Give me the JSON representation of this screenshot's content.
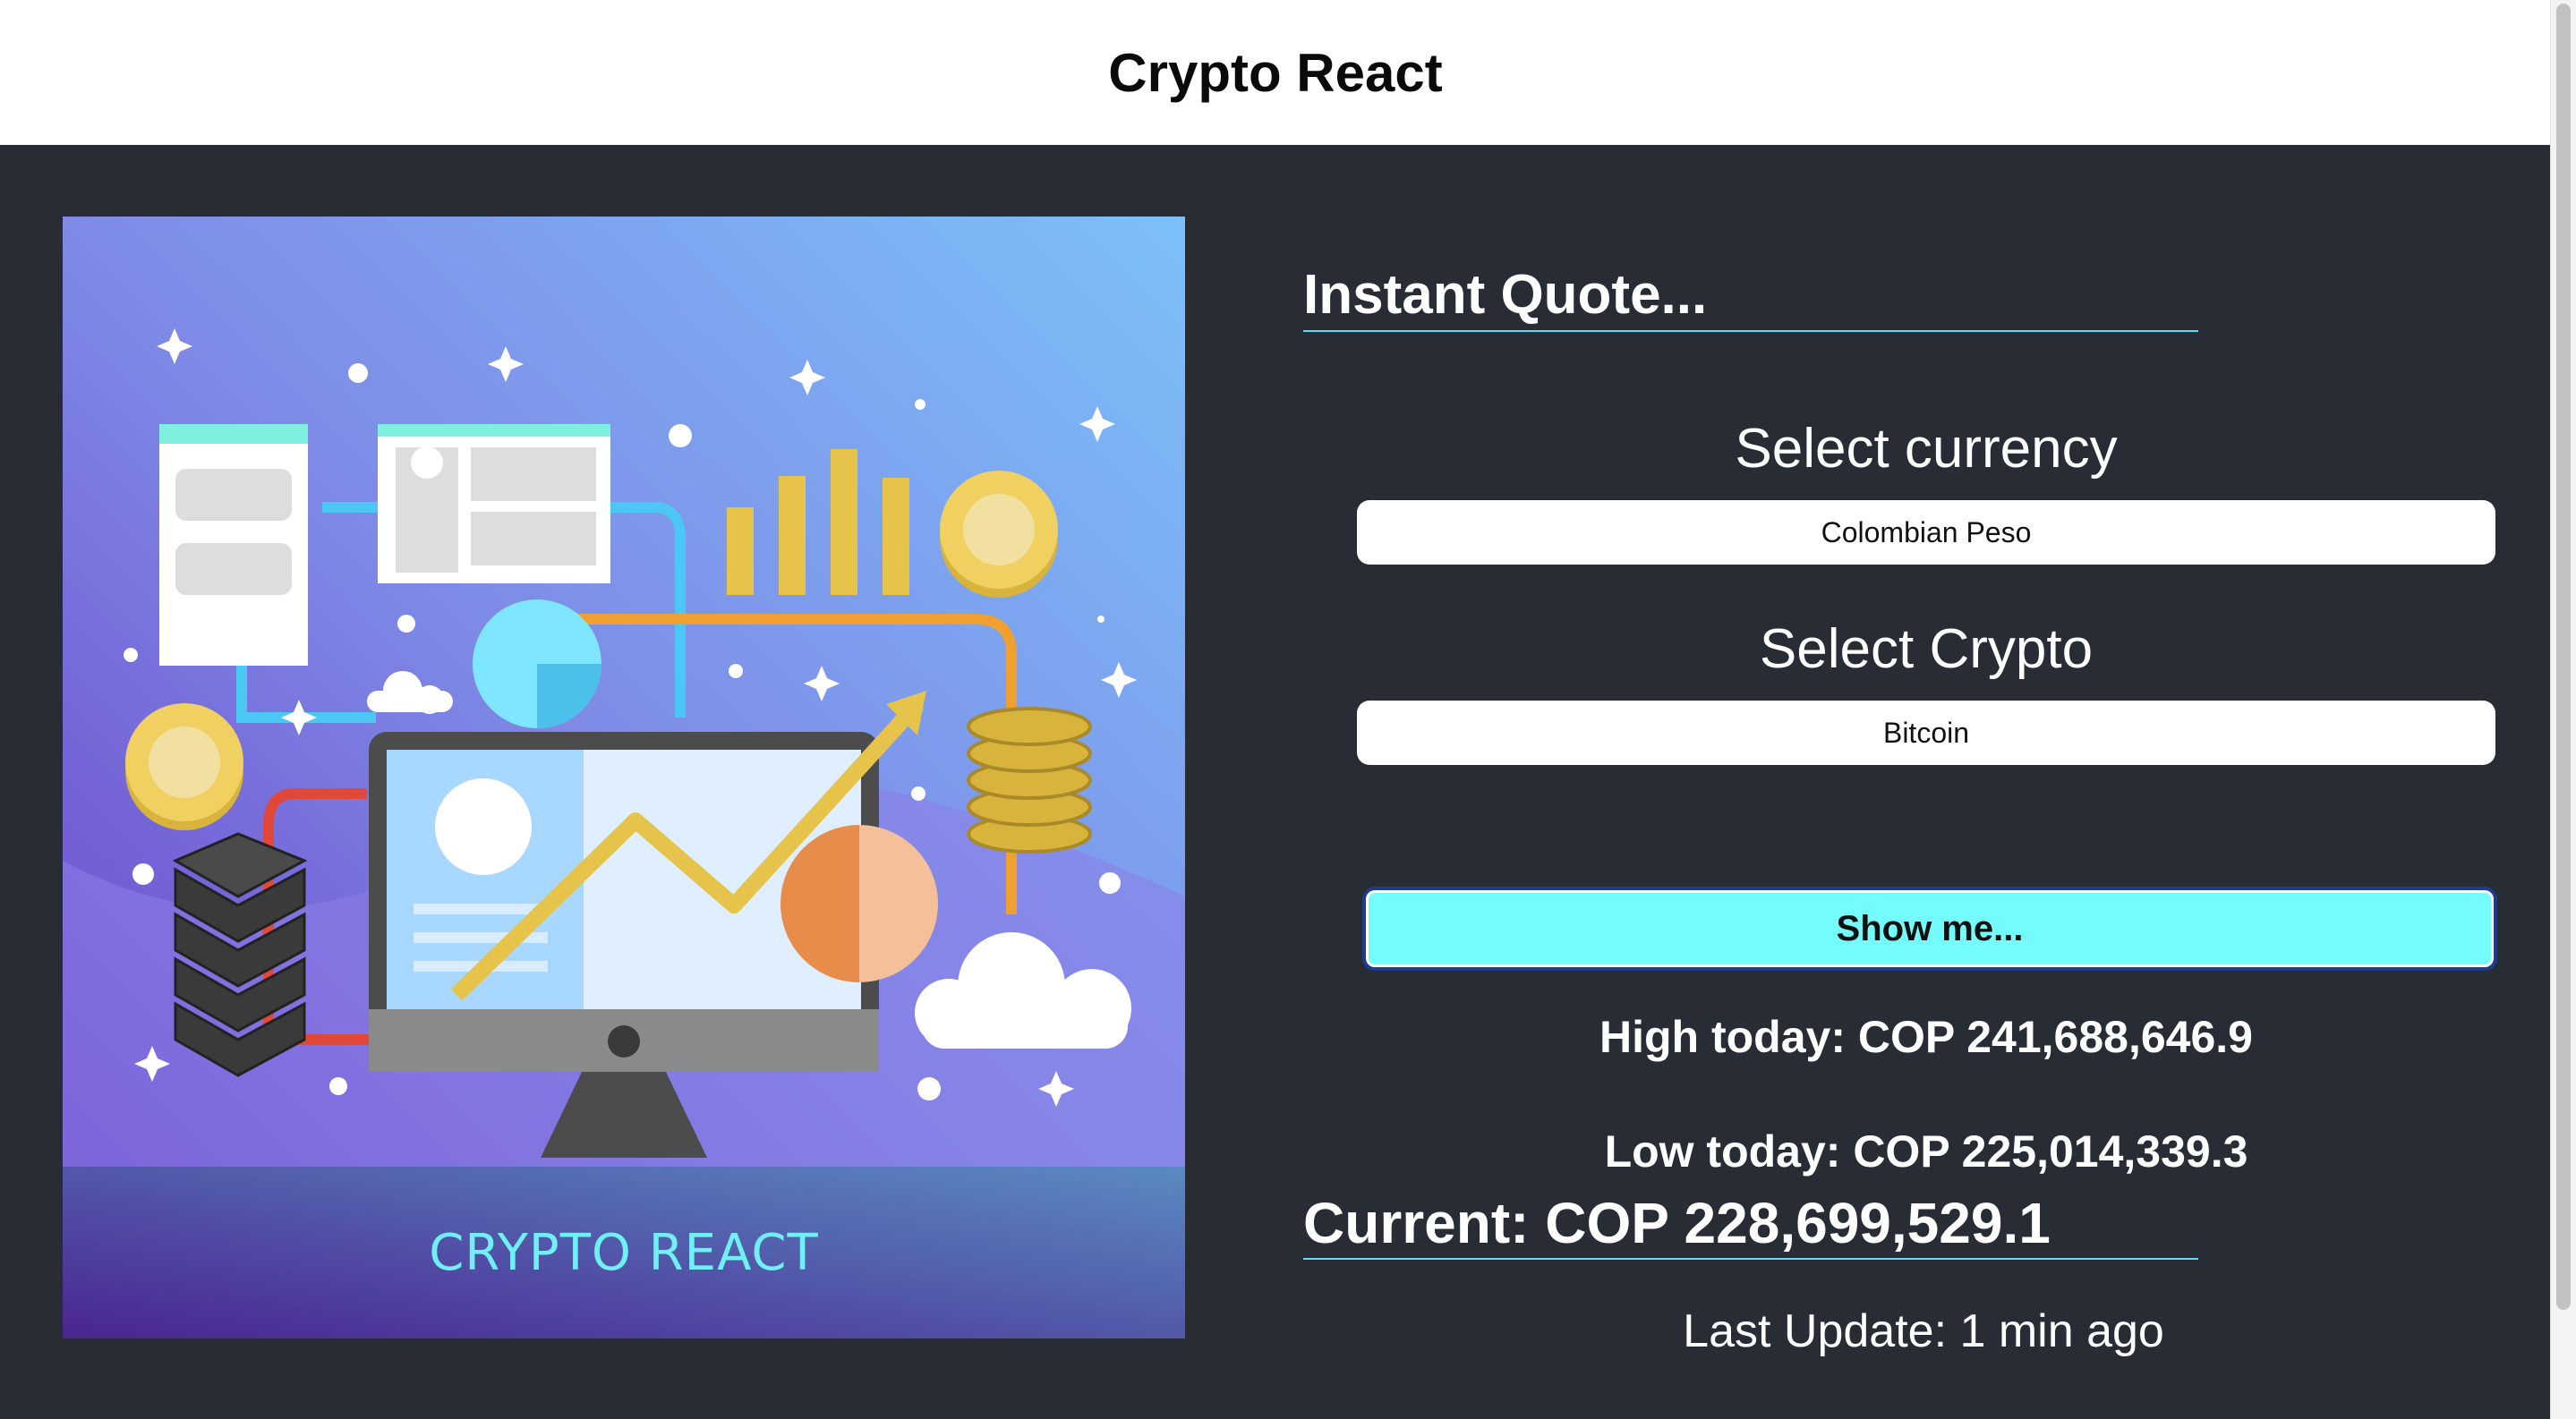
{
  "header": {
    "title": "Crypto React"
  },
  "hero": {
    "caption": "CRYPTO REACT"
  },
  "quote": {
    "heading": "Instant Quote...",
    "currency_label": "Select currency",
    "currency_value": "Colombian Peso",
    "crypto_label": "Select Crypto",
    "crypto_value": "Bitcoin",
    "button_label": "Show me...",
    "high_today": "High today: COP 241,688,646.9",
    "low_today": "Low today: COP 225,014,339.3",
    "current": "Current: COP 228,699,529.1",
    "last_update": "Last Update: 1 min ago"
  },
  "colors": {
    "background": "#282c34",
    "accent": "#61dafb",
    "button": "#74fbfb"
  }
}
